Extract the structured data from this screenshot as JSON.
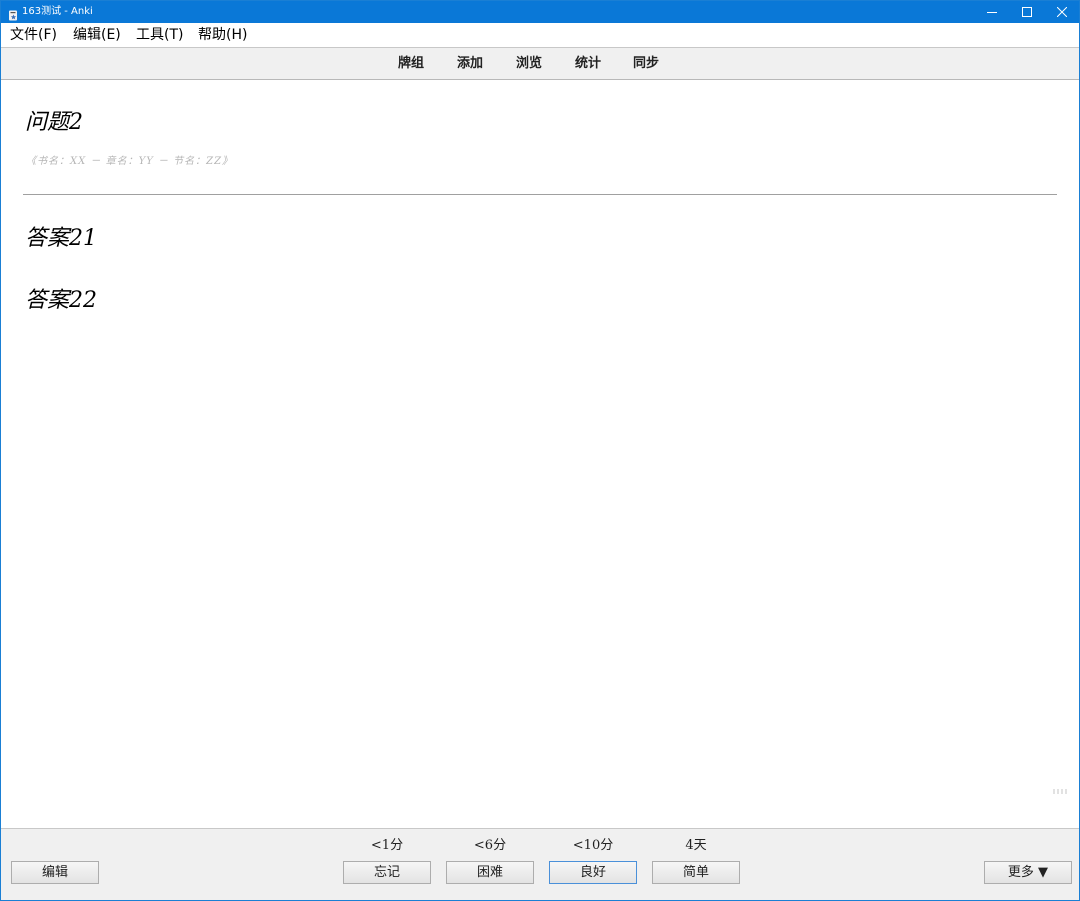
{
  "window": {
    "title": "163测试 - Anki"
  },
  "menu": {
    "file": "文件(F)",
    "edit": "编辑(E)",
    "tools": "工具(T)",
    "help": "帮助(H)"
  },
  "toolbar": {
    "decks": "牌组",
    "add": "添加",
    "browse": "浏览",
    "stats": "统计",
    "sync": "同步"
  },
  "card": {
    "question": "问题2",
    "source": "《书名：XX － 章名：YY － 节名：ZZ》",
    "answers": [
      "答案21",
      "答案22"
    ]
  },
  "bottom": {
    "edit_label": "编辑",
    "more_label": "更多 ▼",
    "answer_buttons": [
      {
        "label": "忘记",
        "interval": "<1分"
      },
      {
        "label": "困难",
        "interval": "<6分"
      },
      {
        "label": "良好",
        "interval": "<10分"
      },
      {
        "label": "简单",
        "interval": "4天"
      }
    ]
  },
  "icons": {
    "app": "anki-icon",
    "minimize": "minimize-icon",
    "maximize": "maximize-icon",
    "close": "close-icon",
    "grip": "resize-grip-icon"
  },
  "colors": {
    "titlebar": "#0a78d7",
    "bars": "#f0f0f0",
    "focus": "#4a90d9"
  }
}
